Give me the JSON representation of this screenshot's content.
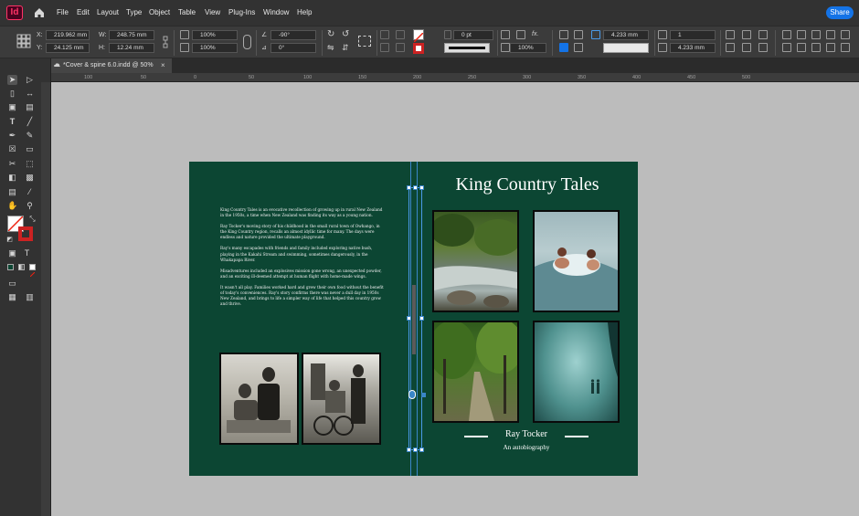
{
  "app": {
    "logo": "Id",
    "share_label": "Share"
  },
  "menu": [
    "File",
    "Edit",
    "Layout",
    "Type",
    "Object",
    "Table",
    "View",
    "Plug-Ins",
    "Window",
    "Help"
  ],
  "control": {
    "x_label": "X:",
    "x_value": "219.962 mm",
    "y_label": "Y:",
    "y_value": "24.125 mm",
    "w_label": "W:",
    "w_value": "248.75 mm",
    "h_label": "H:",
    "h_value": "12.24 mm",
    "scale_x": "100%",
    "scale_y": "100%",
    "rotate": "-90°",
    "shear": "0°",
    "stroke_weight": "0 pt",
    "opacity": "100%",
    "gutter_1": "4.233 mm",
    "gutter_2": "4.233 mm",
    "columns": "1"
  },
  "tab": {
    "title": "*Cover & spine 6.0.indd @ 50%",
    "close": "×"
  },
  "ruler": {
    "h_ticks": [
      "100",
      "50",
      "0",
      "50",
      "100",
      "150",
      "200",
      "250",
      "300",
      "350",
      "400",
      "450",
      "500"
    ]
  },
  "cover": {
    "title": "King Country Tales",
    "author": "Ray Tocker",
    "subtitle": "An autobiography",
    "blurb": [
      "King Country Tales is an evocative recollection of growing up in rural New Zealand in the 1950s, a time when New Zealand was finding its way as a young nation.",
      "Ray Tocker's moving story of his childhood in the small rural town of Owhango, in the King Country region, recalls an almost idyllic time for many. The days were endless and nature provided the ultimate playground.",
      "Ray's many escapades with friends and family included exploring native bush, playing in the Kakahi Stream and swimming, sometimes dangerously, in the Whakapapa River.",
      "Misadventures included an explosives mission gone wrong, an unexpected powder, and an exciting ill-deemed attempt at human flight with home-made wings.",
      "It wasn't all play. Families worked hard and grew their own food without the benefit of today's conveniences. Ray's story confirms there was never a dull day in 1950s New Zealand, and brings to life a simpler way of life that helped this country grow and thrive."
    ]
  },
  "colors": {
    "cover_bg": "#0c4633",
    "accent": "#1473e6",
    "selection": "#3a86c8"
  }
}
